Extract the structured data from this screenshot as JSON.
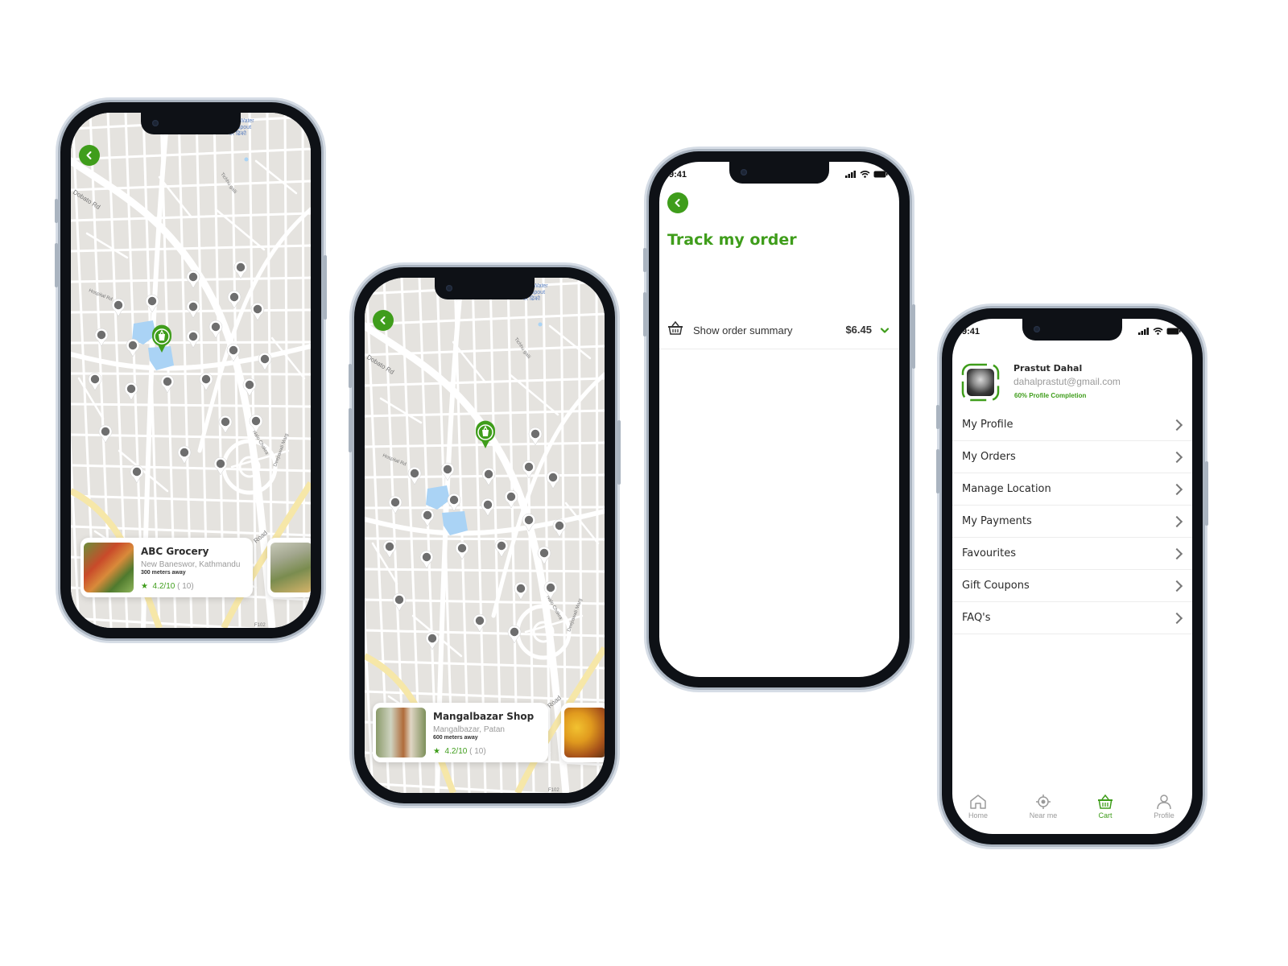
{
  "colors": {
    "accent": "#3f9d1b",
    "pin_gray": "#6e6e6e",
    "map_bg": "#e5e3df",
    "road": "#ffffff",
    "water": "#aad3f5"
  },
  "map_labels": {
    "dobato": "Dobato Rd",
    "hospital": "Hospital Rd",
    "tichhu": "Tichhu galli",
    "water_spout": "Ga: Water\nne Spout\nघर ढिको",
    "nalo": "Nalo Chakra",
    "deepawali": "Deepawali Marg",
    "f102": "F102",
    "road": "Road"
  },
  "phone1": {
    "back_icon": "chevron-left-icon",
    "shop": {
      "name": "ABC Grocery",
      "address": "New Baneswor, Kathmandu",
      "distance": "300 meters away",
      "rating": "4.2/10",
      "count": "( 10)"
    }
  },
  "phone2": {
    "back_icon": "chevron-left-icon",
    "shop": {
      "name": "Mangalbazar Shop",
      "address": "Mangalbazar, Patan",
      "distance": "600 meters away",
      "rating": "4.2/10",
      "count": "( 10)"
    }
  },
  "phone3": {
    "time": "9:41",
    "title": "Track my order",
    "summary_label": "Show order summary",
    "summary_price": "$6.45",
    "basket_icon": "basket-icon"
  },
  "phone4": {
    "time": "9:41",
    "user": {
      "name": "Prastut Dahal",
      "email": "dahalprastut@gmail.com",
      "completion": "60% Profile Completion"
    },
    "menu": [
      "My Profile",
      "My Orders",
      "Manage Location",
      "My Payments",
      "Favourites",
      "Gift Coupons",
      "FAQ's"
    ],
    "tabs": [
      {
        "label": "Home",
        "icon": "home-icon"
      },
      {
        "label": "Near me",
        "icon": "location-icon"
      },
      {
        "label": "Cart",
        "icon": "basket-icon"
      },
      {
        "label": "Profile",
        "icon": "user-icon"
      }
    ],
    "active_tab": "Cart"
  }
}
